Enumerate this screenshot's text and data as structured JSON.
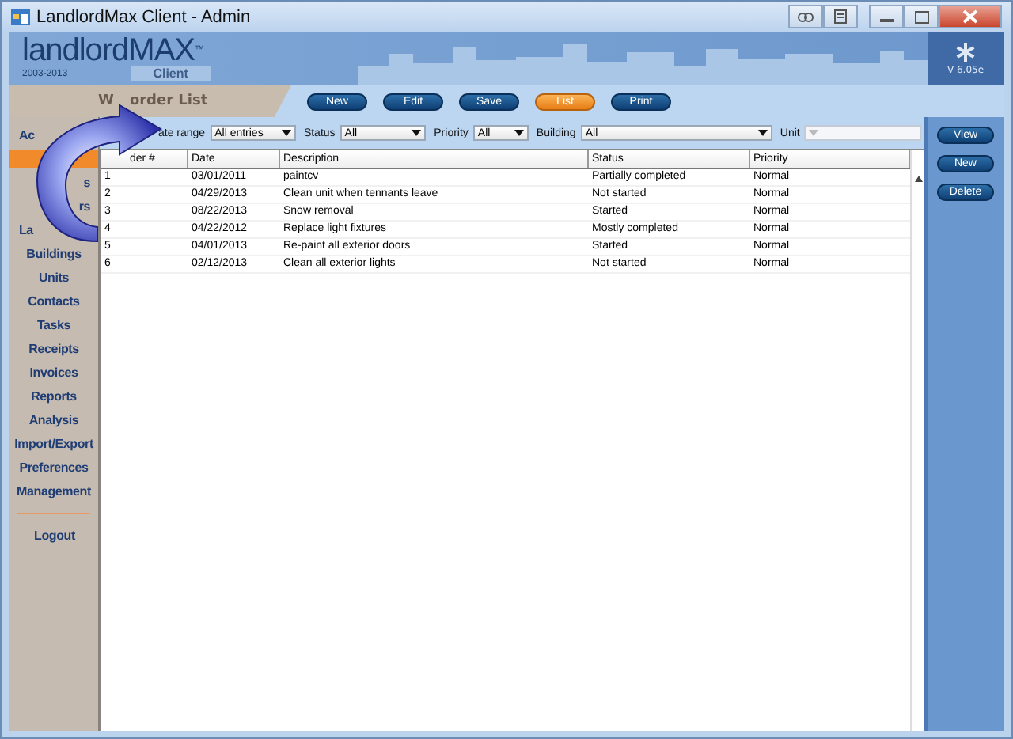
{
  "window": {
    "title": "LandlordMax Client - Admin"
  },
  "logo": {
    "name": "landlordMAX",
    "tm": "™",
    "years": "2003-2013",
    "edition": "Client",
    "version": "V 6.05e"
  },
  "page_title": {
    "start": "W",
    "end": "order List"
  },
  "toolbar": [
    {
      "label": "New",
      "selected": false
    },
    {
      "label": "Edit",
      "selected": false
    },
    {
      "label": "Save",
      "selected": false
    },
    {
      "label": "List",
      "selected": true
    },
    {
      "label": "Print",
      "selected": false
    }
  ],
  "filters": [
    {
      "label": "ate range",
      "value": "All entries",
      "disabled": false
    },
    {
      "label": "Status",
      "value": "All",
      "disabled": false
    },
    {
      "label": "Priority",
      "value": "All",
      "disabled": false
    },
    {
      "label": "Building",
      "value": "All",
      "disabled": false
    },
    {
      "label": "Unit",
      "disabled": true
    }
  ],
  "sidebar": {
    "items": [
      {
        "label": "Ac",
        "selected": false
      },
      {
        "selected": true
      },
      {
        "label": "s",
        "selected": false
      },
      {
        "label": "rs",
        "selected": false
      },
      {
        "label": "La",
        "selected": false
      },
      {
        "label": "Buildings",
        "selected": false
      },
      {
        "label": "Units",
        "selected": false
      },
      {
        "label": "Contacts",
        "selected": false
      },
      {
        "label": "Tasks",
        "selected": false
      },
      {
        "label": "Receipts",
        "selected": false
      },
      {
        "label": "Invoices",
        "selected": false
      },
      {
        "label": "Reports",
        "selected": false
      },
      {
        "label": "Analysis",
        "selected": false
      },
      {
        "label": "Import/Export",
        "selected": false
      },
      {
        "label": "Preferences",
        "selected": false
      },
      {
        "label": "Management",
        "selected": false
      }
    ],
    "logout": "Logout"
  },
  "table": {
    "columns": [
      "der #",
      "Date",
      "Description",
      "Status",
      "Priority"
    ],
    "rows": [
      [
        "1",
        "03/01/2011",
        "paintcv",
        "Partially completed",
        "Normal"
      ],
      [
        "2",
        "04/29/2013",
        "Clean unit when tennants leave",
        "Not started",
        "Normal"
      ],
      [
        "3",
        "08/22/2013",
        "Snow removal",
        "Started",
        "Normal"
      ],
      [
        "4",
        "04/22/2012",
        "Replace light fixtures",
        "Mostly completed",
        "Normal"
      ],
      [
        "5",
        "04/01/2013",
        "Re-paint all exterior doors",
        "Started",
        "Normal"
      ],
      [
        "6",
        "02/12/2013",
        "Clean all exterior lights",
        "Not started",
        "Normal"
      ]
    ]
  },
  "actions": [
    "View",
    "New",
    "Delete"
  ]
}
